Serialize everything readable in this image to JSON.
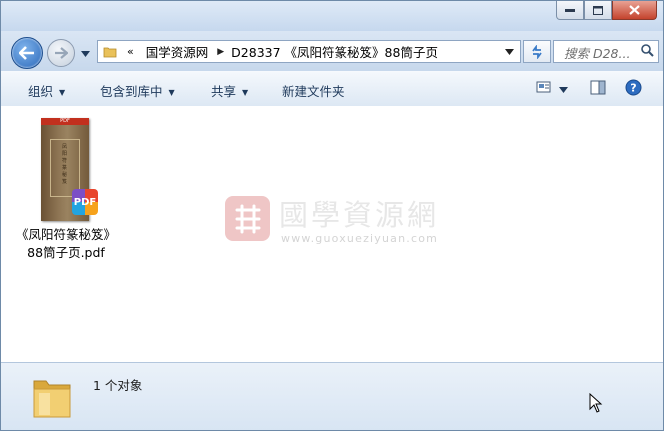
{
  "address": {
    "crumbs": [
      "国学资源网",
      "D28337 《凤阳符篆秘笈》88筒子页"
    ],
    "overflow": "«"
  },
  "search": {
    "placeholder": "搜索 D28..."
  },
  "toolbar": {
    "organize": "组织",
    "include_library": "包含到库中",
    "share": "共享",
    "new_folder": "新建文件夹"
  },
  "files": [
    {
      "name_line1": "《凤阳符篆秘笈》",
      "name_line2": "88筒子页.pdf",
      "thumb_banner": "PDF",
      "thumb_title": "凤阳符篆秘笈",
      "badge": "PDF",
      "icon": "pdf-file-icon"
    }
  ],
  "watermark": {
    "title": "國學資源網",
    "url": "www.guoxueziyuan.com"
  },
  "status": {
    "count_text": "1 个对象"
  },
  "colors": {
    "accent": "#1e395b",
    "seal": "#efc6c6",
    "close": "#c4432d"
  }
}
